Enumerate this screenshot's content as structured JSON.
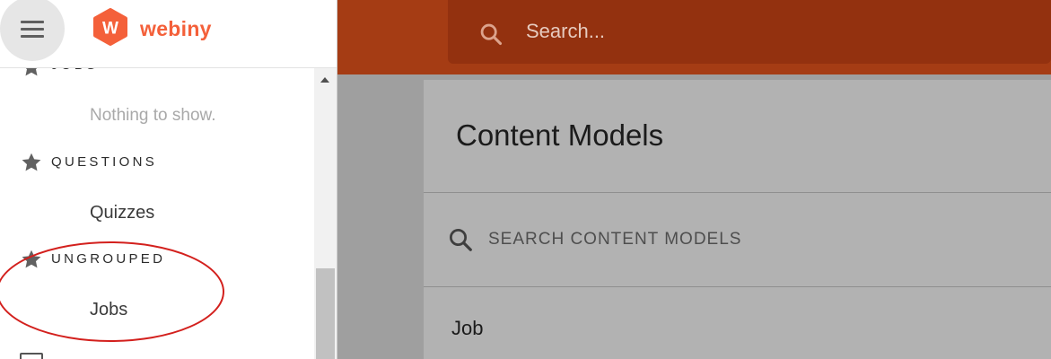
{
  "topbar": {
    "search_placeholder": "Search..."
  },
  "main": {
    "title": "Content Models",
    "search_placeholder": "SEARCH CONTENT MODELS",
    "models": [
      {
        "name": "Job"
      }
    ]
  },
  "brand": {
    "name": "webiny",
    "logo_letter": "W",
    "accent": "#f4603a"
  },
  "drawer": {
    "groups": [
      {
        "title": "JOBS",
        "items": [],
        "empty_text": "Nothing to show."
      },
      {
        "title": "QUESTIONS",
        "items": [
          {
            "label": "Quizzes"
          }
        ]
      },
      {
        "title": "UNGROUPED",
        "items": [
          {
            "label": "Jobs"
          }
        ]
      }
    ]
  },
  "colors": {
    "topbar": "#a53c14",
    "highlight": "#d3201d"
  }
}
